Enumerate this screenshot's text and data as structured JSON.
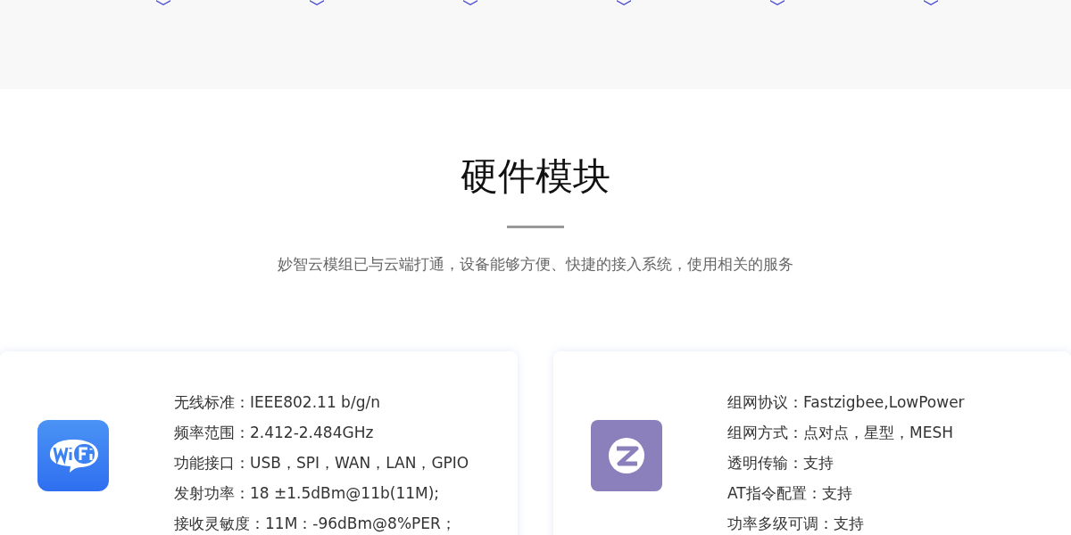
{
  "section": {
    "title": "硬件模块",
    "subtitle": "妙智云模组已与云端打通，设备能够方便、快捷的接入系统，使用相关的服务"
  },
  "modules": [
    {
      "kind": "wifi",
      "specs": [
        "无线标准：IEEE802.11 b/g/n",
        "频率范围：2.412-2.484GHz",
        "功能接口：USB，SPI，WAN，LAN，GPIO",
        "发射功率：18 ±1.5dBm@11b(11M);",
        "接收灵敏度：11M：-96dBm@8%PER；"
      ]
    },
    {
      "kind": "zigbee",
      "specs": [
        "组网协议：Fastzigbee,LowPower",
        "组网方式：点对点，星型，MESH",
        "透明传输：支持",
        "AT指令配置：支持",
        "功率多级可调：支持"
      ]
    }
  ]
}
